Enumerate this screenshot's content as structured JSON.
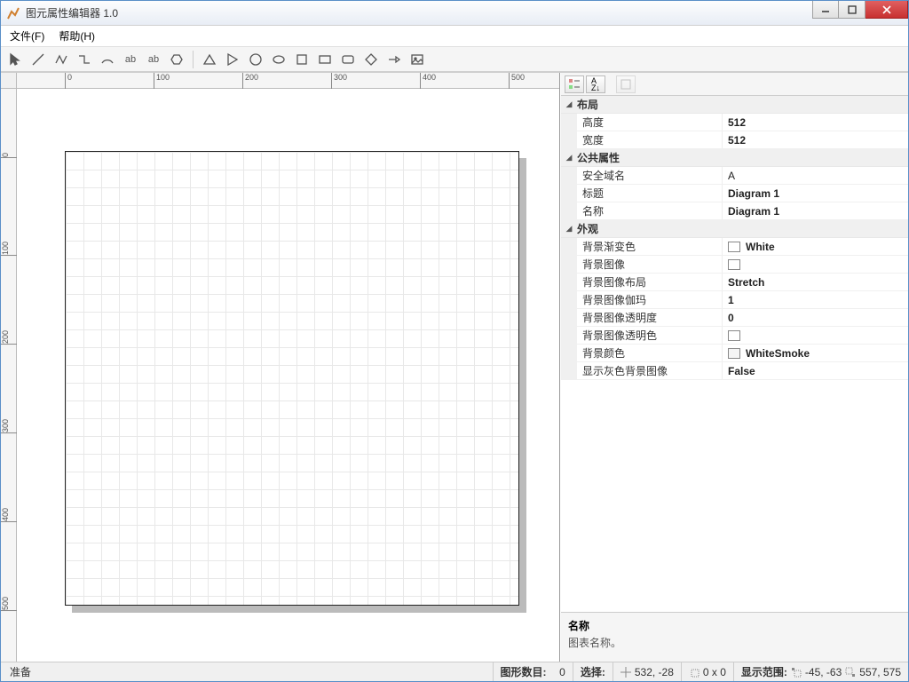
{
  "title": "图元属性编辑器 1.0",
  "menu": {
    "file": "文件(F)",
    "help": "帮助(H)"
  },
  "ruler_h": [
    "0",
    "100",
    "200",
    "300",
    "400",
    "500"
  ],
  "ruler_v": [
    "0",
    "100",
    "200",
    "300",
    "400",
    "500"
  ],
  "props": {
    "cat_layout": "布局",
    "height_label": "高度",
    "height_val": "512",
    "width_label": "宽度",
    "width_val": "512",
    "cat_public": "公共属性",
    "domain_label": "安全域名",
    "domain_val": "A",
    "title_label": "标题",
    "title_val": "Diagram 1",
    "name_label": "名称",
    "name_val": "Diagram 1",
    "cat_appearance": "外观",
    "bg_grad_label": "背景渐变色",
    "bg_grad_val": "White",
    "bg_grad_color": "#ffffff",
    "bg_img_label": "背景图像",
    "bg_img_layout_label": "背景图像布局",
    "bg_img_layout_val": "Stretch",
    "bg_img_gamma_label": "背景图像伽玛",
    "bg_img_gamma_val": "1",
    "bg_img_opacity_label": "背景图像透明度",
    "bg_img_opacity_val": "0",
    "bg_img_trans_label": "背景图像透明色",
    "bg_color_label": "背景颜色",
    "bg_color_val": "WhiteSmoke",
    "bg_color_color": "#f5f5f5",
    "show_gray_label": "显示灰色背景图像",
    "show_gray_val": "False"
  },
  "desc": {
    "title": "名称",
    "body": "图表名称。"
  },
  "status": {
    "ready": "准备",
    "shape_count_label": "图形数目:",
    "shape_count_val": "0",
    "select_label": "选择:",
    "coord": "532, -28",
    "size": "0 x 0",
    "range_label": "显示范围:",
    "range_min": "-45, -63",
    "range_max": "557, 575"
  }
}
